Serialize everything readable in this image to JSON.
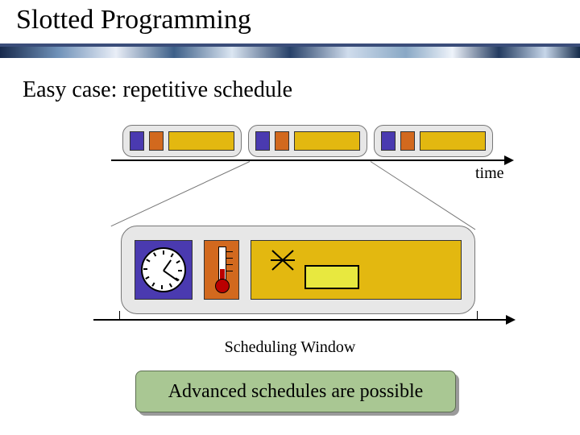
{
  "title": "Slotted Programming",
  "subtitle": "Easy case: repetitive schedule",
  "timeline": {
    "axis_label": "time"
  },
  "scheduling_window": {
    "label": "Scheduling Window"
  },
  "callout": {
    "text": "Advanced schedules are possible"
  },
  "icons": {
    "clock": "clock-icon",
    "thermometer": "thermometer-icon",
    "radio": "radio-antenna-icon"
  },
  "colors": {
    "purple": "#4a3ab0",
    "orange": "#d2691e",
    "yellow": "#e3b810",
    "callout_bg": "#a9c793"
  }
}
